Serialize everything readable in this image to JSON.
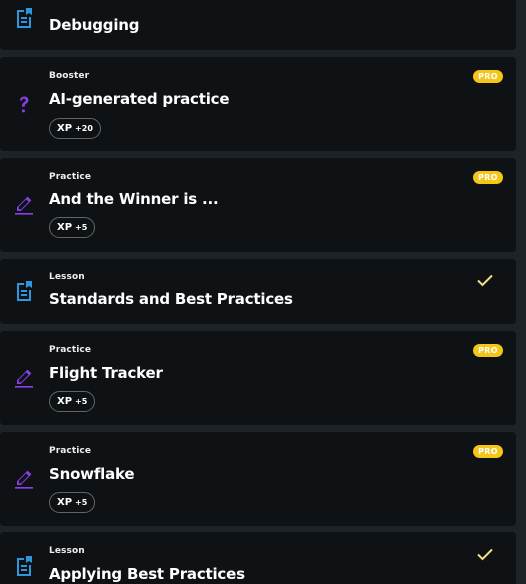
{
  "colors": {
    "lesson_icon": "#2f95dc",
    "practice_icon": "#8a3ee8",
    "booster_icon": "#8a3ee8",
    "pro_badge": "#f5c518",
    "check": "#f5e07a",
    "card_bg": "#0f1214",
    "page_bg": "#1e2327"
  },
  "items": [
    {
      "kind": "",
      "title": "Debugging",
      "icon": "lesson-icon",
      "xp_label": "",
      "xp_value": "",
      "pro": "",
      "completed": false
    },
    {
      "kind": "Booster",
      "title": "AI-generated practice",
      "icon": "question-mark-icon",
      "xp_label": "XP",
      "xp_value": "+20",
      "pro": "PRO",
      "completed": false
    },
    {
      "kind": "Practice",
      "title": "And the Winner is ...",
      "icon": "pencil-icon",
      "xp_label": "XP",
      "xp_value": "+5",
      "pro": "PRO",
      "completed": false
    },
    {
      "kind": "Lesson",
      "title": "Standards and Best Practices",
      "icon": "lesson-icon",
      "xp_label": "",
      "xp_value": "",
      "pro": "",
      "completed": true
    },
    {
      "kind": "Practice",
      "title": "Flight Tracker",
      "icon": "pencil-icon",
      "xp_label": "XP",
      "xp_value": "+5",
      "pro": "PRO",
      "completed": false
    },
    {
      "kind": "Practice",
      "title": "Snowflake",
      "icon": "pencil-icon",
      "xp_label": "XP",
      "xp_value": "+5",
      "pro": "PRO",
      "completed": false
    },
    {
      "kind": "Lesson",
      "title": "Applying Best Practices",
      "icon": "lesson-icon",
      "xp_label": "",
      "xp_value": "",
      "pro": "",
      "completed": true
    }
  ]
}
